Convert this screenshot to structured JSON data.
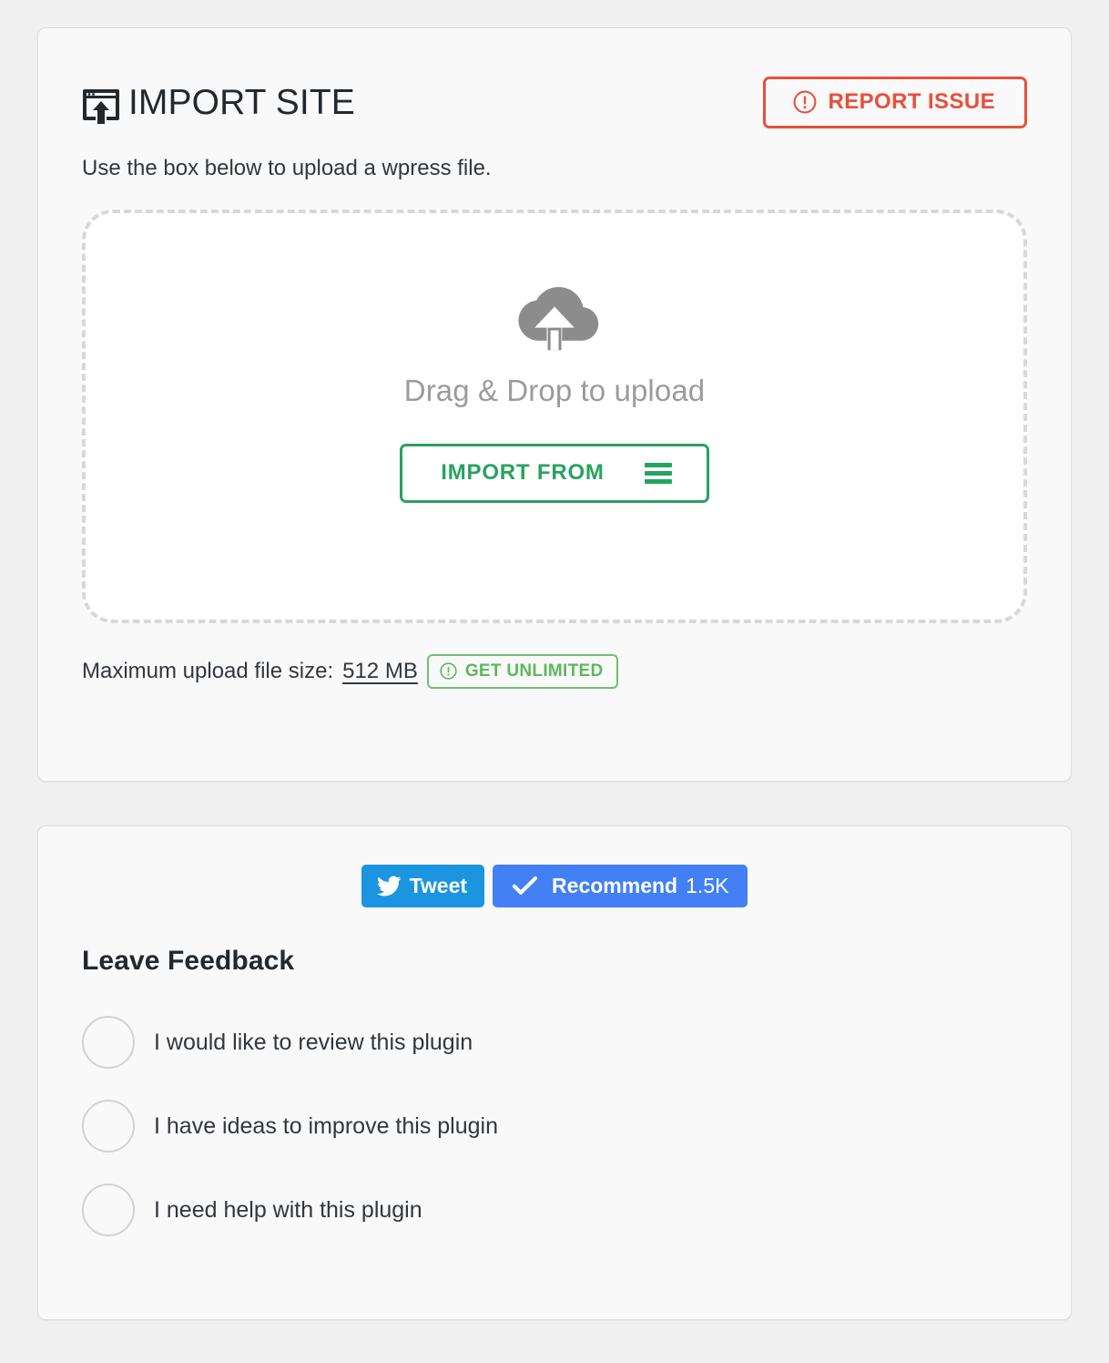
{
  "colors": {
    "page_bg": "#f0f0f1",
    "panel_bg": "#f9f9f9",
    "panel_border": "#dcdcdc",
    "accent_red": "#e8503a",
    "accent_green": "#27a360",
    "light_green": "#5cb85c",
    "twitter_blue": "#1b95e0",
    "facebook_blue": "#4280f4",
    "dashed_border": "#d8d8d8",
    "muted_text": "#9b9b9b",
    "body_text": "#32373c"
  },
  "import_panel": {
    "icon": "import-site-icon",
    "title": "IMPORT SITE",
    "report_issue": {
      "label": "REPORT ISSUE",
      "icon": "exclamation-circle-icon"
    },
    "subtitle": "Use the box below to upload a wpress file.",
    "dropzone": {
      "icon": "cloud-upload-icon",
      "text": "Drag & Drop to upload",
      "import_from_button": {
        "label": "IMPORT FROM",
        "icon": "hamburger-menu-icon"
      }
    },
    "max_upload": {
      "label": "Maximum upload file size:",
      "value": "512 MB",
      "get_unlimited": {
        "label": "GET UNLIMITED",
        "icon": "exclamation-circle-icon"
      }
    }
  },
  "feedback_panel": {
    "social": {
      "tweet": {
        "label": "Tweet",
        "icon": "twitter-bird-icon"
      },
      "recommend": {
        "label": "Recommend",
        "count": "1.5K",
        "icon": "check-icon"
      }
    },
    "title": "Leave Feedback",
    "options": [
      {
        "label": "I would like to review this plugin"
      },
      {
        "label": "I have ideas to improve this plugin"
      },
      {
        "label": "I need help with this plugin"
      }
    ]
  }
}
